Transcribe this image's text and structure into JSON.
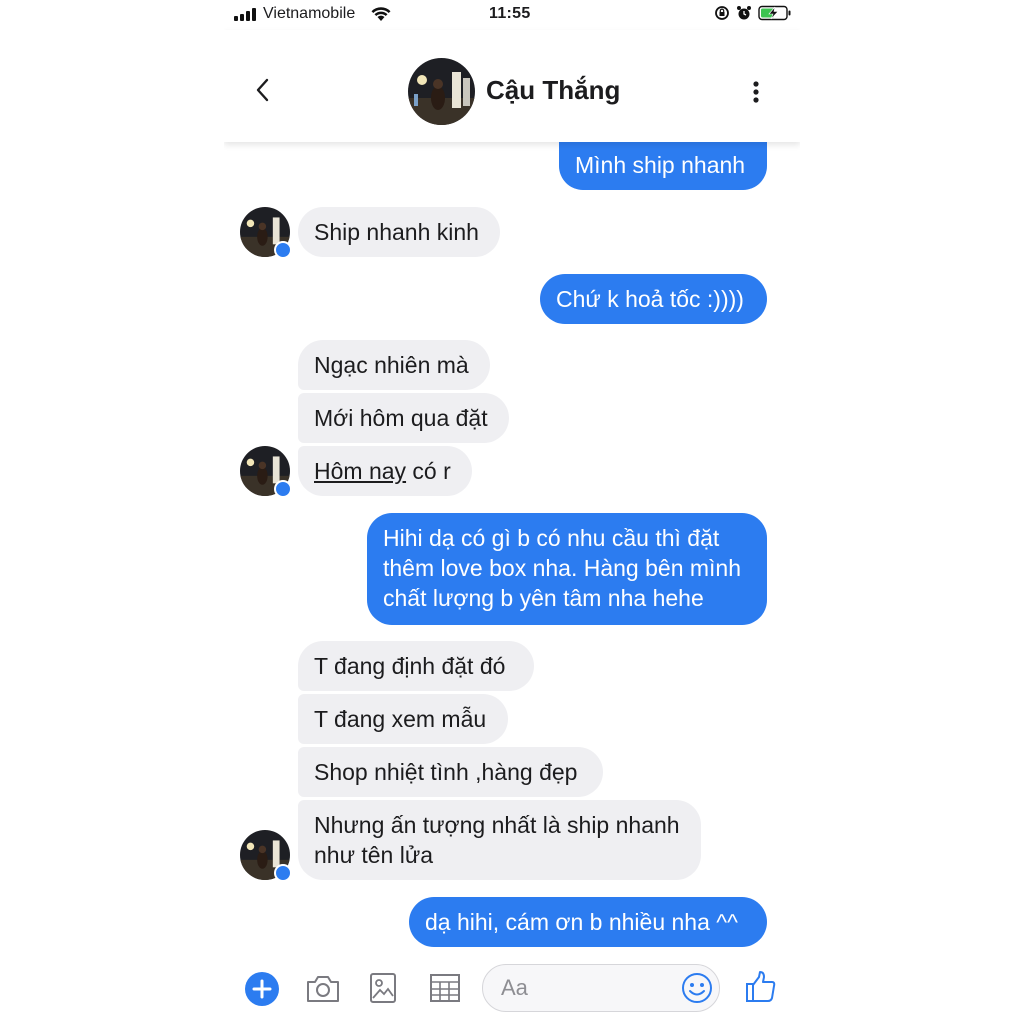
{
  "status": {
    "carrier": "Vietnamobile",
    "time": "11:55"
  },
  "header": {
    "contact_name": "Cậu Thắng"
  },
  "messages": [
    {
      "dir": "out",
      "text": "Mình ship nhanh"
    },
    {
      "dir": "in",
      "text": "Ship nhanh kinh"
    },
    {
      "dir": "out",
      "text": "Chứ k hoả tốc :))))"
    },
    {
      "dir": "in",
      "text": "Ngạc nhiên mà"
    },
    {
      "dir": "in",
      "text": "Mới hôm qua đặt"
    },
    {
      "dir": "in",
      "text_underlined": "Hôm nay",
      "text_rest": " có r"
    },
    {
      "dir": "out",
      "lines": [
        "Hihi dạ có gì b có nhu cầu thì đặt",
        "thêm love box nha. Hàng bên mình",
        "chất lượng b yên tâm nha hehe"
      ]
    },
    {
      "dir": "in",
      "text": "T đang định đặt đó"
    },
    {
      "dir": "in",
      "text": "T đang xem mẫu"
    },
    {
      "dir": "in",
      "text": "Shop nhiệt tình ,hàng đẹp"
    },
    {
      "dir": "in",
      "lines": [
        "Nhưng ấn tượng nhất là ship nhanh",
        "như tên lửa"
      ]
    },
    {
      "dir": "out",
      "text": "dạ hihi, cám ơn b nhiều nha ^^"
    }
  ],
  "composer": {
    "placeholder": "Aa"
  },
  "colors": {
    "outgoing": "#2c7cf0",
    "incoming": "#efeff2"
  },
  "icons": [
    "signal-icon",
    "wifi-icon",
    "lock-rotation-icon",
    "alarm-icon",
    "battery-icon",
    "back-chevron-icon",
    "more-vertical-icon",
    "messenger-badge-icon",
    "plus-icon",
    "camera-icon",
    "gallery-icon",
    "sticker-grid-icon",
    "emoji-icon",
    "thumbs-up-icon"
  ]
}
